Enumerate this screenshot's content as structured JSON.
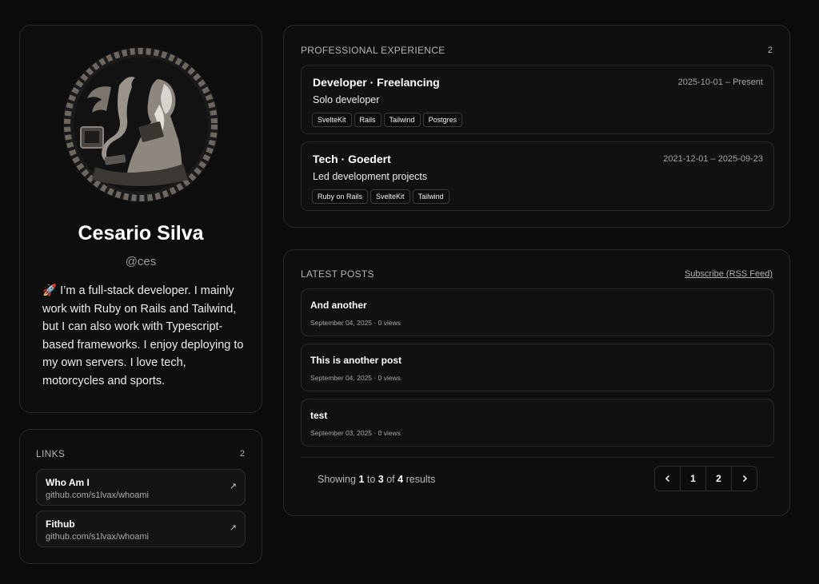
{
  "profile": {
    "name": "Cesario Silva",
    "handle": "@ces",
    "bio": "🚀 I’m a full-stack developer. I mainly work with Ruby on Rails and Tailwind, but I can also work with Typescript-based frameworks. I enjoy deploying to my own servers. I love tech, motorcycles and sports."
  },
  "links": {
    "title": "LINKS",
    "count": "2",
    "items": [
      {
        "title": "Who Am I",
        "url": "github.com/s1lvax/whoami",
        "icon": "arrow-up-right-icon"
      },
      {
        "title": "Fithub",
        "url": "github.com/s1lvax/whoami",
        "icon": "arrow-up-right-icon"
      }
    ]
  },
  "experience": {
    "title": "PROFESSIONAL EXPERIENCE",
    "count": "2",
    "items": [
      {
        "title": "Developer · Freelancing",
        "date": "2025-10-01 – Present",
        "desc": "Solo developer",
        "tags": [
          "SvelteKit",
          "Rails",
          "Tailwind",
          "Postgres"
        ]
      },
      {
        "title": "Tech · Goedert",
        "date": "2021-12-01 – 2025-09-23",
        "desc": "Led development projects",
        "tags": [
          "Ruby on Rails",
          "SvelteKit",
          "Tailwind"
        ]
      }
    ]
  },
  "posts": {
    "title": "LATEST POSTS",
    "rss": "Subscribe (RSS Feed)",
    "items": [
      {
        "title": "And another",
        "meta": "September 04, 2025 · 0 views"
      },
      {
        "title": "This is another post",
        "meta": "September 04, 2025 · 0 views"
      },
      {
        "title": "test",
        "meta": "September 03, 2025 · 0 views"
      }
    ],
    "showing": {
      "prefix": "Showing",
      "from": "1",
      "to_word": "to",
      "to": "3",
      "of_word": "of",
      "total": "4",
      "suffix": "results"
    },
    "pager": {
      "pages": [
        "1",
        "2"
      ],
      "prev_icon": "chevron-left-icon",
      "next_icon": "chevron-right-icon"
    }
  }
}
